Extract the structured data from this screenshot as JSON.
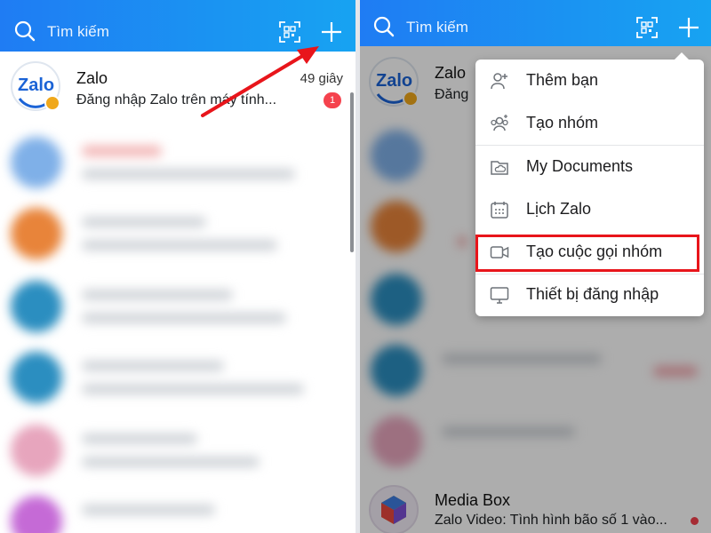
{
  "left_screen": {
    "search": {
      "placeholder": "Tìm kiếm"
    },
    "conversation": {
      "name": "Zalo",
      "avatar_text": "Zalo",
      "preview": "Đăng nhập Zalo trên máy tính...",
      "time": "49 giây",
      "unread": "1"
    }
  },
  "right_screen": {
    "search": {
      "placeholder": "Tìm kiếm"
    },
    "partial_conversation": {
      "name": "Zalo",
      "preview": "Đăng"
    },
    "menu": {
      "items": [
        {
          "label": "Thêm bạn",
          "icon": "add-friend-icon"
        },
        {
          "label": "Tạo nhóm",
          "icon": "create-group-icon"
        },
        {
          "label": "My Documents",
          "icon": "cloud-folder-icon"
        },
        {
          "label": "Lịch Zalo",
          "icon": "calendar-icon"
        },
        {
          "label": "Tạo cuộc gọi nhóm",
          "icon": "video-call-icon"
        },
        {
          "label": "Thiết bị đăng nhập",
          "icon": "monitor-icon"
        }
      ],
      "highlighted_item": "Tạo cuộc gọi nhóm"
    },
    "bottom_conversation": {
      "name": "Media Box",
      "preview": "Zalo Video: Tình hình bão số 1 vào..."
    }
  },
  "colors": {
    "header_start": "#1f7cf3",
    "header_end": "#17a3f2",
    "annotation_red": "#e8151b",
    "badge_red": "#f5424d"
  }
}
